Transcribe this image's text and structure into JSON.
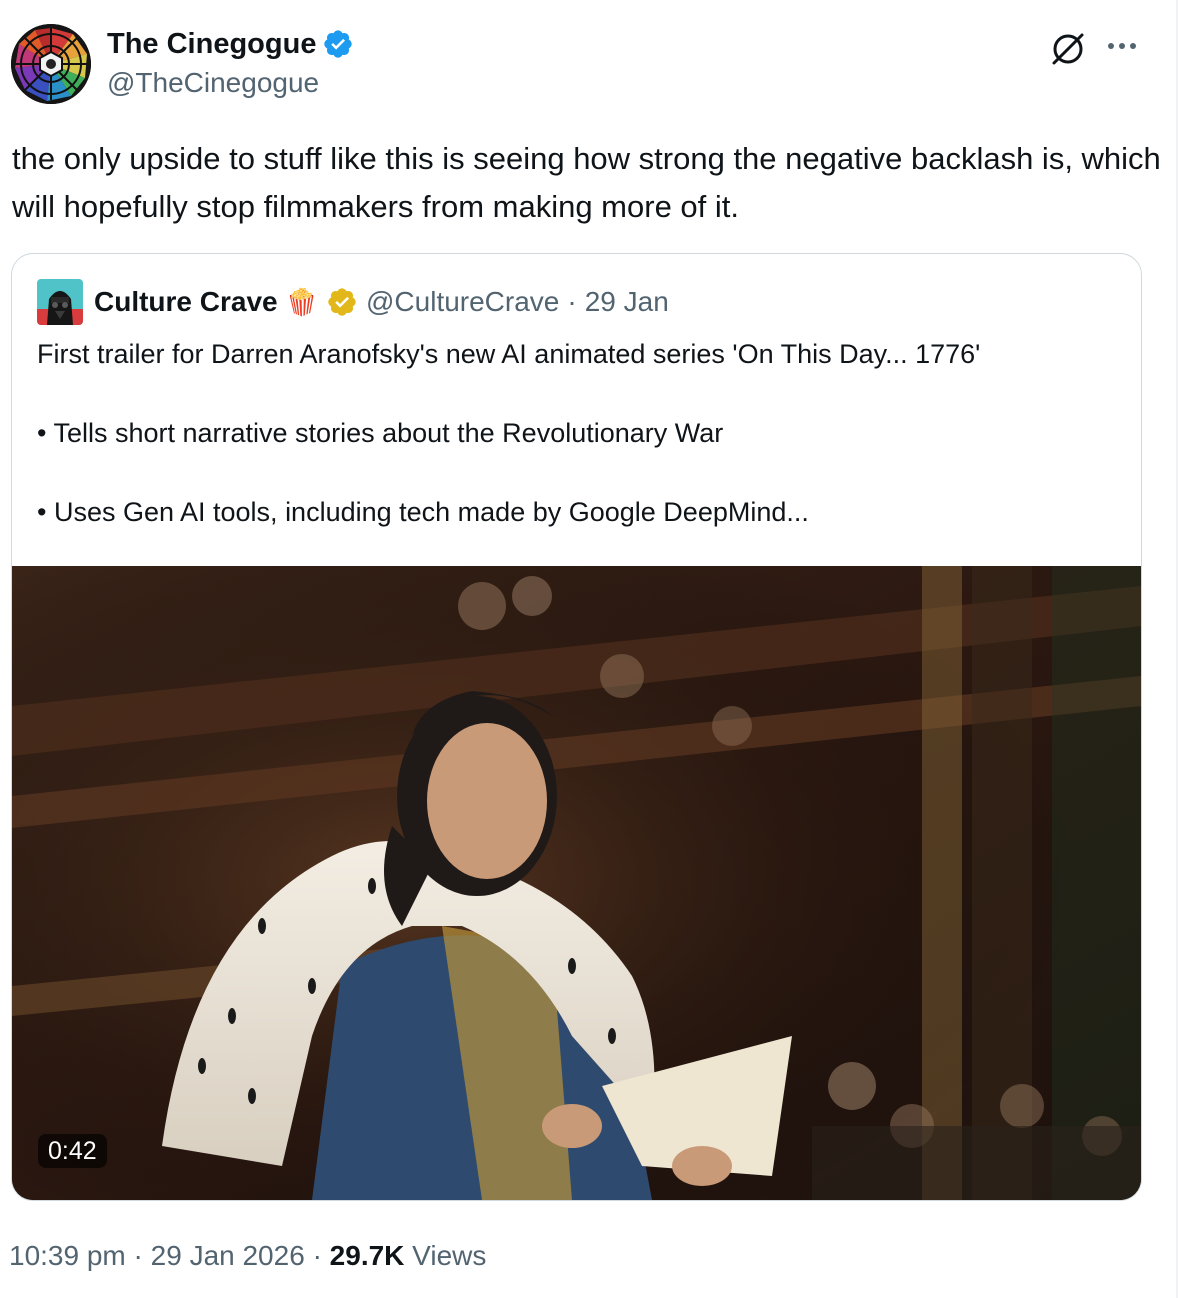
{
  "tweet": {
    "author_name": "The Cinegogue",
    "author_handle": "@TheCinegogue",
    "text": "the only upside to stuff like this is seeing how strong the negative backlash is, which will hopefully stop filmmakers from making more of it.",
    "time": "10:39 pm",
    "date": "29 Jan 2026",
    "views_count": "29.7K",
    "views_label": "Views",
    "separator": "·"
  },
  "quote": {
    "author_name": "Culture Crave",
    "author_emoji": "🍿",
    "author_handle": "@CultureCrave",
    "date": "29 Jan",
    "separator": "·",
    "lines": [
      "First trailer for Darren Aranofsky's new AI animated series 'On This Day... 1776'",
      "• Tells short narrative stories about the Revolutionary War",
      "• Uses Gen AI tools, including tech made by Google DeepMind..."
    ],
    "video_duration": "0:42"
  },
  "icons": {
    "verified": "verified-badge-blue",
    "quote_verified": "verified-badge-gold",
    "grok": "grok-icon",
    "more": "more-icon"
  },
  "colors": {
    "verified_blue": "#1d9bf0",
    "verified_gold": "#e2b719",
    "secondary_text": "#536471",
    "primary_text": "#0f1419"
  }
}
